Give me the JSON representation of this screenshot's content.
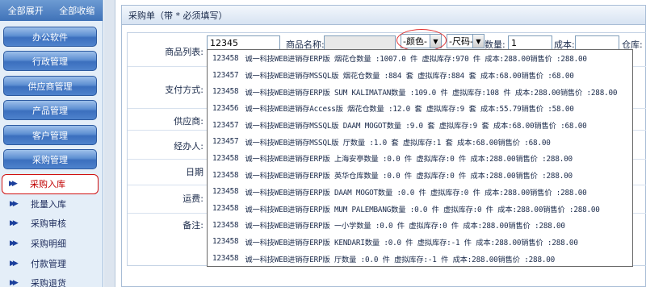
{
  "sidebar": {
    "expand_all": "全部展开",
    "collapse_all": "全部收缩",
    "groups": [
      {
        "label": "办公软件"
      },
      {
        "label": "行政管理"
      },
      {
        "label": "供应商管理"
      },
      {
        "label": "产品管理"
      },
      {
        "label": "客户管理"
      },
      {
        "label": "采购管理"
      }
    ],
    "sub_items": [
      {
        "label": "采购入库",
        "active": true
      },
      {
        "label": "批量入库"
      },
      {
        "label": "采购审核"
      },
      {
        "label": "采购明细"
      },
      {
        "label": "付款管理"
      },
      {
        "label": "采购退货"
      }
    ]
  },
  "panel": {
    "title": "采购单（带 * 必须填写）"
  },
  "form": {
    "labels": {
      "product_list": "商品列表:",
      "payment": "支付方式:",
      "supplier": "供应商:",
      "handler": "经办人:",
      "date": "日期",
      "freight": "运费:",
      "remark": "备注:"
    },
    "product_input_value": "12345",
    "product_name_label": "商品名称:",
    "color_select": "-颜色-",
    "size_select": "-尺码-",
    "quantity_label": "数量:",
    "quantity_value": "1",
    "cost_label": "成本:",
    "warehouse_label": "仓库:"
  },
  "autocomplete": {
    "rows": [
      {
        "code": "123458",
        "text": "诚一科技WEB进销存ERP版 烟花仓数量 :1007.0 件 虚拟库存:970 件 成本:288.00销售价 :288.00"
      },
      {
        "code": "123457",
        "text": "诚一科技WEB进销存MSSQL版 烟花仓数量 :884 套 虚拟库存:884 套 成本:68.00销售价 :68.00"
      },
      {
        "code": "123458",
        "text": "诚一科技WEB进销存ERP版 SUM KALIMATAN数量 :109.0 件 虚拟库存:108 件 成本:288.00销售价 :288.00"
      },
      {
        "code": "123456",
        "text": "诚一科技WEB进销存Access版 烟花仓数量 :12.0 套 虚拟库存:9 套 成本:55.79销售价 :58.00"
      },
      {
        "code": "123457",
        "text": "诚一科技WEB进销存MSSQL版 DAAM MOGOT数量 :9.0 套 虚拟库存:9 套 成本:68.00销售价 :68.00"
      },
      {
        "code": "123457",
        "text": "诚一科技WEB进销存MSSQL版 厅数量 :1.0 套 虚拟库存:1 套 成本:68.00销售价 :68.00"
      },
      {
        "code": "123458",
        "text": "诚一科技WEB进销存ERP版 上海安亭数量 :0.0 件 虚拟库存:0 件 成本:288.00销售价 :288.00"
      },
      {
        "code": "123458",
        "text": "诚一科技WEB进销存ERP版 英华仓库数量 :0.0 件 虚拟库存:0 件 成本:288.00销售价 :288.00"
      },
      {
        "code": "123458",
        "text": "诚一科技WEB进销存ERP版 DAAM MOGOT数量 :0.0 件 虚拟库存:0 件 成本:288.00销售价 :288.00"
      },
      {
        "code": "123458",
        "text": "诚一科技WEB进销存ERP版 MUM PALEMBANG数量 :0.0 件 虚拟库存:0 件 成本:288.00销售价 :288.00"
      },
      {
        "code": "123458",
        "text": "诚一科技WEB进销存ERP版 一小学数量 :0.0 件 虚拟库存:0 件 成本:288.00销售价 :288.00"
      },
      {
        "code": "123458",
        "text": "诚一科技WEB进销存ERP版 KENDARI数量 :0.0 件 虚拟库存:-1 件 成本:288.00销售价 :288.00"
      },
      {
        "code": "123458",
        "text": "诚一科技WEB进销存ERP版 厅数量 :0.0 件 虚拟库存:-1 件 成本:288.00销售价 :288.00"
      }
    ]
  }
}
